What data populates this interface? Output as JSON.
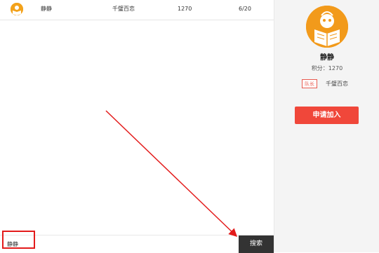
{
  "results": [
    {
      "name": "静静",
      "team": "千璧百恋",
      "score": "1270",
      "members": "6/20"
    }
  ],
  "search": {
    "value": "静静",
    "button_label": "搜索"
  },
  "profile": {
    "name": "静静",
    "score_text": "积分：1270",
    "role_tag": "队长",
    "team": "千璧百恋",
    "join_label": "申请加入"
  },
  "colors": {
    "accent": "#f0473a",
    "avatar_orange": "#f29a1b",
    "annotation_red": "#e31b1b",
    "search_button_bg": "#333333"
  }
}
